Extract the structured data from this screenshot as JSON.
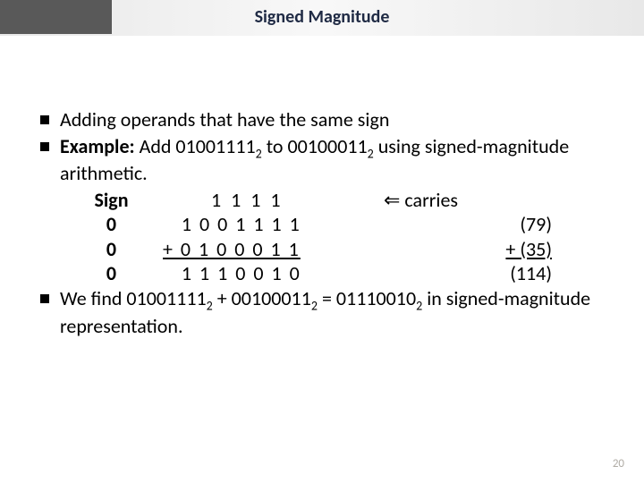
{
  "title": "Signed Magnitude",
  "bullets": [
    "Adding operands that have the same sign"
  ],
  "example": {
    "label": "Example:",
    "add_word": " Add ",
    "op1_bits": "01001111",
    "to_word": " to ",
    "op2_bits": "00100011",
    "base": "2",
    "using": " using signed-magnitude arithmetic."
  },
  "work": {
    "sign_label": "Sign",
    "carries": "1 1 1 1",
    "carries_arrow": "⇐ ",
    "carries_word": "carries",
    "rows": [
      {
        "sign": "0",
        "bits": "   1 0 0 1 1 1 1",
        "dec": "(79)"
      },
      {
        "sign": "0",
        "bits": "+ 0 1 0 0 0 1 1",
        "dec": "+ (35)"
      },
      {
        "sign": "0",
        "bits": "   1 1 1 0 0 1 0",
        "dec": "(114)"
      }
    ]
  },
  "conclusion": {
    "prefix": "We find ",
    "a": "01001111",
    "plus": " + ",
    "b": "00100011",
    "eq": " = ",
    "r": "01110010",
    "suffix": " in signed-magnitude representation."
  },
  "page": "20"
}
